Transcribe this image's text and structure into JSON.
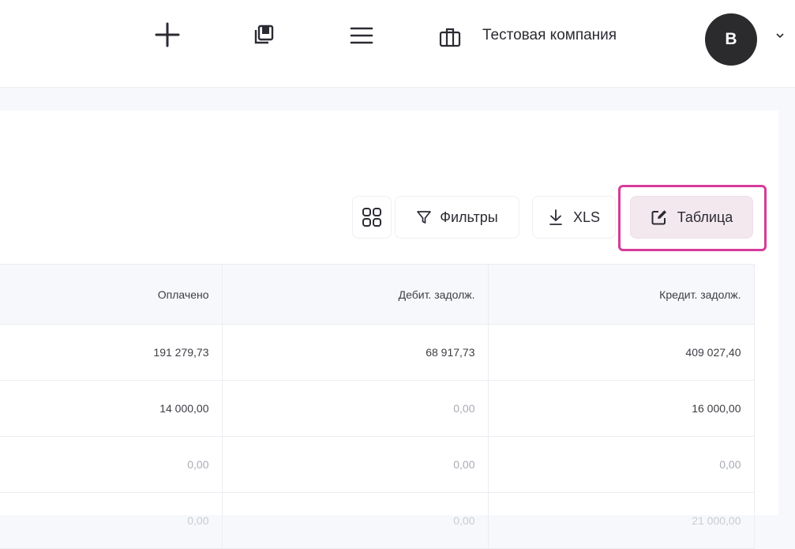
{
  "header": {
    "company_name": "Тестовая компания",
    "avatar_letter": "В",
    "icons": [
      "plus-icon",
      "pages-icon",
      "menu-icon",
      "briefcase-icon",
      "chevron-down-icon"
    ]
  },
  "toolbar": {
    "filters_label": "Фильтры",
    "xls_label": "XLS",
    "table_label": "Таблица",
    "highlight_color": "#d63b9a"
  },
  "table": {
    "columns": [
      "Оплачено",
      "Дебит. задолж.",
      "Кредит. задолж."
    ],
    "rows": [
      [
        "191 279,73",
        "68 917,73",
        "409 027,40"
      ],
      [
        "14 000,00",
        "0,00",
        "16 000,00"
      ],
      [
        "0,00",
        "0,00",
        "0,00"
      ],
      [
        "0,00",
        "0,00",
        "21 000,00"
      ]
    ]
  }
}
